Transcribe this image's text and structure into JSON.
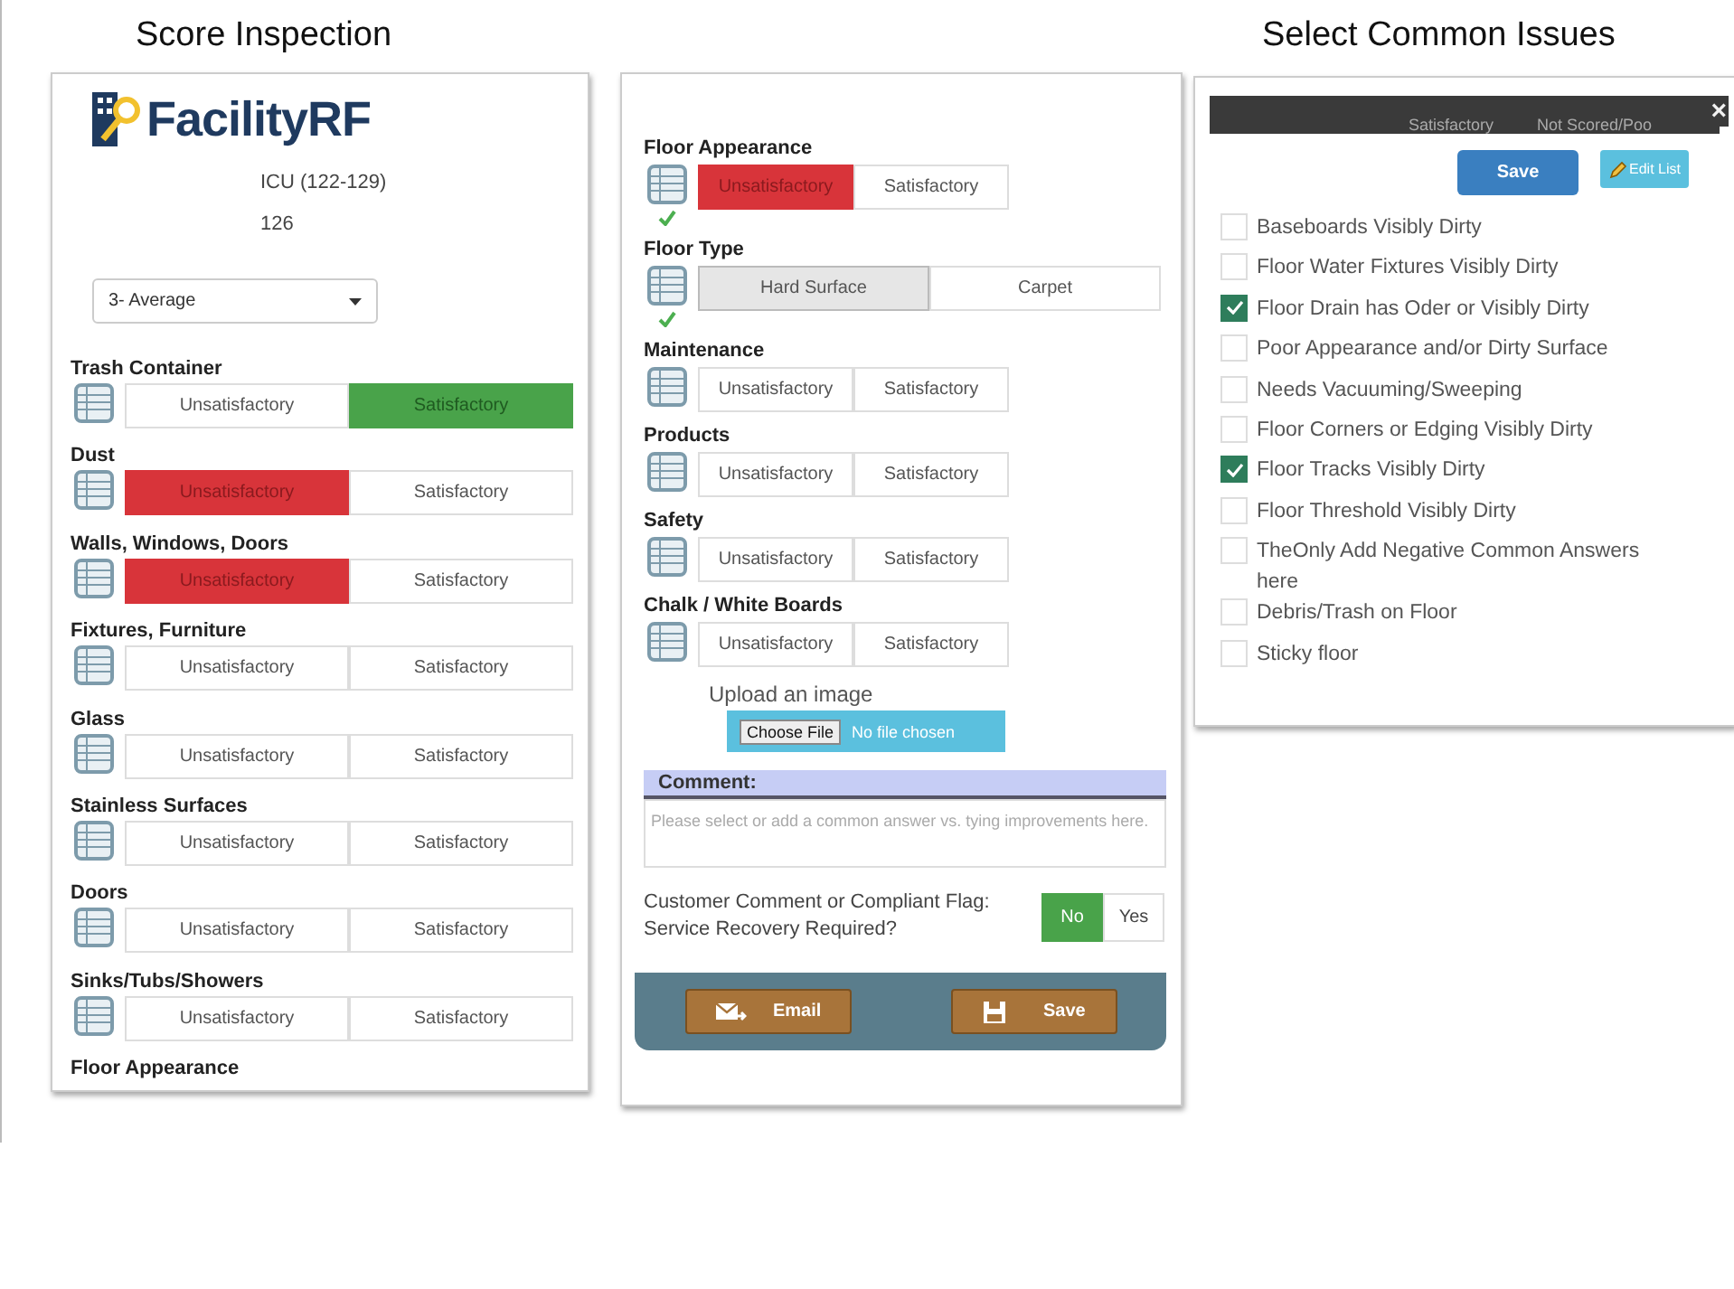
{
  "score_inspection": {
    "title": "Score Inspection",
    "logo_text": "FacilityRF",
    "location": "ICU (122-129)",
    "room": "126",
    "rating_select": "3- Average",
    "items": [
      {
        "label": "Trash Container",
        "options": [
          {
            "label": "Unsatisfactory",
            "kind": "negative",
            "selected": false
          },
          {
            "label": "Satisfactory",
            "kind": "positive",
            "selected": true
          }
        ]
      },
      {
        "label": "Dust",
        "options": [
          {
            "label": "Unsatisfactory",
            "kind": "negative",
            "selected": true
          },
          {
            "label": "Satisfactory",
            "kind": "positive",
            "selected": false
          }
        ]
      },
      {
        "label": "Walls, Windows, Doors",
        "options": [
          {
            "label": "Unsatisfactory",
            "kind": "negative",
            "selected": true
          },
          {
            "label": "Satisfactory",
            "kind": "positive",
            "selected": false
          }
        ]
      },
      {
        "label": "Fixtures, Furniture",
        "options": [
          {
            "label": "Unsatisfactory",
            "kind": "negative",
            "selected": false
          },
          {
            "label": "Satisfactory",
            "kind": "positive",
            "selected": false
          }
        ]
      },
      {
        "label": "Glass",
        "options": [
          {
            "label": "Unsatisfactory",
            "kind": "negative",
            "selected": false
          },
          {
            "label": "Satisfactory",
            "kind": "positive",
            "selected": false
          }
        ]
      },
      {
        "label": "Stainless Surfaces",
        "options": [
          {
            "label": "Unsatisfactory",
            "kind": "negative",
            "selected": false
          },
          {
            "label": "Satisfactory",
            "kind": "positive",
            "selected": false
          }
        ]
      },
      {
        "label": "Doors",
        "options": [
          {
            "label": "Unsatisfactory",
            "kind": "negative",
            "selected": false
          },
          {
            "label": "Satisfactory",
            "kind": "positive",
            "selected": false
          }
        ]
      },
      {
        "label": "Sinks/Tubs/Showers",
        "options": [
          {
            "label": "Unsatisfactory",
            "kind": "negative",
            "selected": false
          },
          {
            "label": "Satisfactory",
            "kind": "positive",
            "selected": false
          }
        ]
      }
    ],
    "trailing_label": "Floor Appearance"
  },
  "inspection_continued": {
    "items": [
      {
        "label": "Floor Appearance",
        "verified": true,
        "wide": false,
        "options": [
          {
            "label": "Unsatisfactory",
            "kind": "negative",
            "selected": true
          },
          {
            "label": "Satisfactory",
            "kind": "positive",
            "selected": false
          }
        ]
      },
      {
        "label": "Floor Type",
        "verified": true,
        "wide": true,
        "options": [
          {
            "label": "Hard Surface",
            "kind": "neutral",
            "selected": true
          },
          {
            "label": "Carpet",
            "kind": "neutral",
            "selected": false
          }
        ]
      },
      {
        "label": "Maintenance",
        "verified": false,
        "wide": false,
        "options": [
          {
            "label": "Unsatisfactory",
            "kind": "negative",
            "selected": false
          },
          {
            "label": "Satisfactory",
            "kind": "positive",
            "selected": false
          }
        ]
      },
      {
        "label": "Products",
        "verified": false,
        "wide": false,
        "options": [
          {
            "label": "Unsatisfactory",
            "kind": "negative",
            "selected": false
          },
          {
            "label": "Satisfactory",
            "kind": "positive",
            "selected": false
          }
        ]
      },
      {
        "label": "Safety",
        "verified": false,
        "wide": false,
        "options": [
          {
            "label": "Unsatisfactory",
            "kind": "negative",
            "selected": false
          },
          {
            "label": "Satisfactory",
            "kind": "positive",
            "selected": false
          }
        ]
      },
      {
        "label": "Chalk / White Boards",
        "verified": false,
        "wide": false,
        "options": [
          {
            "label": "Unsatisfactory",
            "kind": "negative",
            "selected": false
          },
          {
            "label": "Satisfactory",
            "kind": "positive",
            "selected": false
          }
        ]
      }
    ],
    "upload": {
      "label": "Upload an image",
      "button": "Choose File",
      "status": "No file chosen"
    },
    "comment": {
      "title": "Comment:",
      "placeholder": "Please select or add a common answer vs. tying improvements here."
    },
    "flag": {
      "question": "Customer Comment or Compliant Flag: Service Recovery Required?",
      "options": [
        {
          "label": "No",
          "selected": true
        },
        {
          "label": "Yes",
          "selected": false
        }
      ]
    },
    "footer_buttons": [
      {
        "label": "Email",
        "kind": "email"
      },
      {
        "label": "Save",
        "kind": "save"
      }
    ]
  },
  "common_issues": {
    "title": "Select Common Issues",
    "close": "×",
    "background_texts": [
      "Satisfactory",
      "Not Scored/Poo"
    ],
    "save_button": "Save",
    "edit_button": "Edit List",
    "issues": [
      {
        "label": "Baseboards Visibly Dirty",
        "checked": false
      },
      {
        "label": "Floor Water Fixtures Visibly Dirty",
        "checked": false
      },
      {
        "label": "Floor Drain has Oder or Visibly Dirty",
        "checked": true
      },
      {
        "label": "Poor Appearance and/or Dirty Surface",
        "checked": false
      },
      {
        "label": "Needs Vacuuming/Sweeping",
        "checked": false
      },
      {
        "label": "Floor Corners or Edging Visibly Dirty",
        "checked": false
      },
      {
        "label": "Floor Tracks Visibly Dirty",
        "checked": true
      },
      {
        "label": "Floor Threshold Visibly Dirty",
        "checked": false
      },
      {
        "label": "TheOnly Add Negative Common Answers here",
        "checked": false
      },
      {
        "label": "Debris/Trash on Floor",
        "checked": false
      },
      {
        "label": "Sticky floor",
        "checked": false
      }
    ]
  }
}
